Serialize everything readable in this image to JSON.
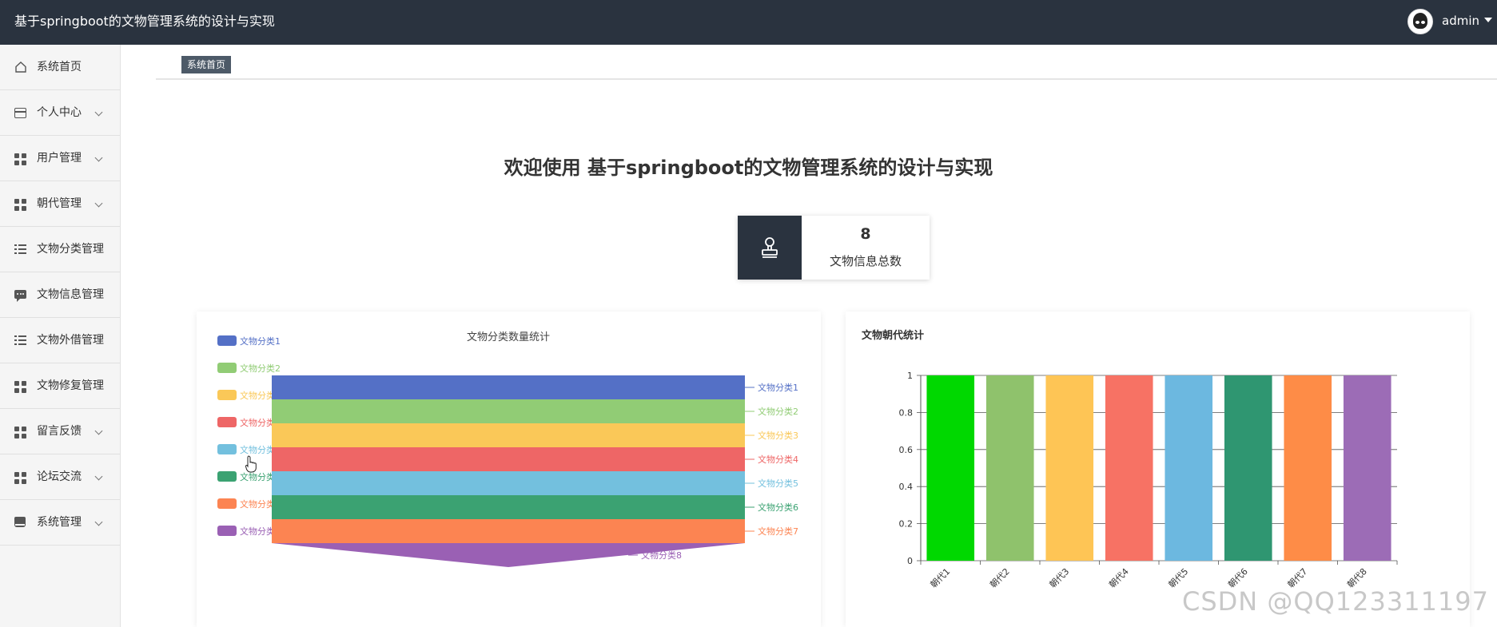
{
  "header": {
    "app_title": "基于springboot的文物管理系统的设计与实现",
    "user_name": "admin"
  },
  "sidebar": {
    "items": [
      {
        "label": "系统首页",
        "icon": "home-icon",
        "has_submenu": false
      },
      {
        "label": "个人中心",
        "icon": "card-icon",
        "has_submenu": true
      },
      {
        "label": "用户管理",
        "icon": "grid-icon",
        "has_submenu": true
      },
      {
        "label": "朝代管理",
        "icon": "grid-icon",
        "has_submenu": true
      },
      {
        "label": "文物分类管理",
        "icon": "list-icon",
        "has_submenu": false
      },
      {
        "label": "文物信息管理",
        "icon": "chat-icon",
        "has_submenu": false
      },
      {
        "label": "文物外借管理",
        "icon": "list-icon",
        "has_submenu": false
      },
      {
        "label": "文物修复管理",
        "icon": "grid-icon",
        "has_submenu": false
      },
      {
        "label": "留言反馈",
        "icon": "grid-icon",
        "has_submenu": true
      },
      {
        "label": "论坛交流",
        "icon": "grid-icon",
        "has_submenu": true
      },
      {
        "label": "系统管理",
        "icon": "book-icon",
        "has_submenu": true
      }
    ]
  },
  "breadcrumb": {
    "current": "系统首页"
  },
  "main": {
    "welcome_text": "欢迎使用 基于springboot的文物管理系统的设计与实现",
    "stat": {
      "value": "8",
      "label": "文物信息总数",
      "icon": "stamp-icon"
    }
  },
  "colors": {
    "topbar": "#2a333f",
    "series": [
      "#5470c6",
      "#91cc75",
      "#fac858",
      "#ee6666",
      "#73c0de",
      "#3ba272",
      "#fc8452",
      "#9a60b4"
    ],
    "bar_colors": [
      "#00d800",
      "#8fc26c",
      "#fec555",
      "#f77264",
      "#6cb8e0",
      "#2f9671",
      "#fe8c47",
      "#9c6cb6"
    ]
  },
  "watermark": "CSDN @QQ123311197",
  "chart_data": [
    {
      "type": "funnel",
      "title": "文物分类数量统计",
      "categories": [
        "文物分类1",
        "文物分类2",
        "文物分类3",
        "文物分类4",
        "文物分类5",
        "文物分类6",
        "文物分类7",
        "文物分类8"
      ],
      "values": [
        1,
        1,
        1,
        1,
        1,
        1,
        1,
        1
      ],
      "legend": "left"
    },
    {
      "type": "bar",
      "title": "文物朝代统计",
      "categories": [
        "朝代1",
        "朝代2",
        "朝代3",
        "朝代4",
        "朝代5",
        "朝代6",
        "朝代7",
        "朝代8"
      ],
      "values": [
        1,
        1,
        1,
        1,
        1,
        1,
        1,
        1
      ],
      "ylim": [
        0,
        1
      ],
      "yticks": [
        "0",
        "0.2",
        "0.4",
        "0.6",
        "0.8",
        "1"
      ],
      "grid": true
    }
  ]
}
